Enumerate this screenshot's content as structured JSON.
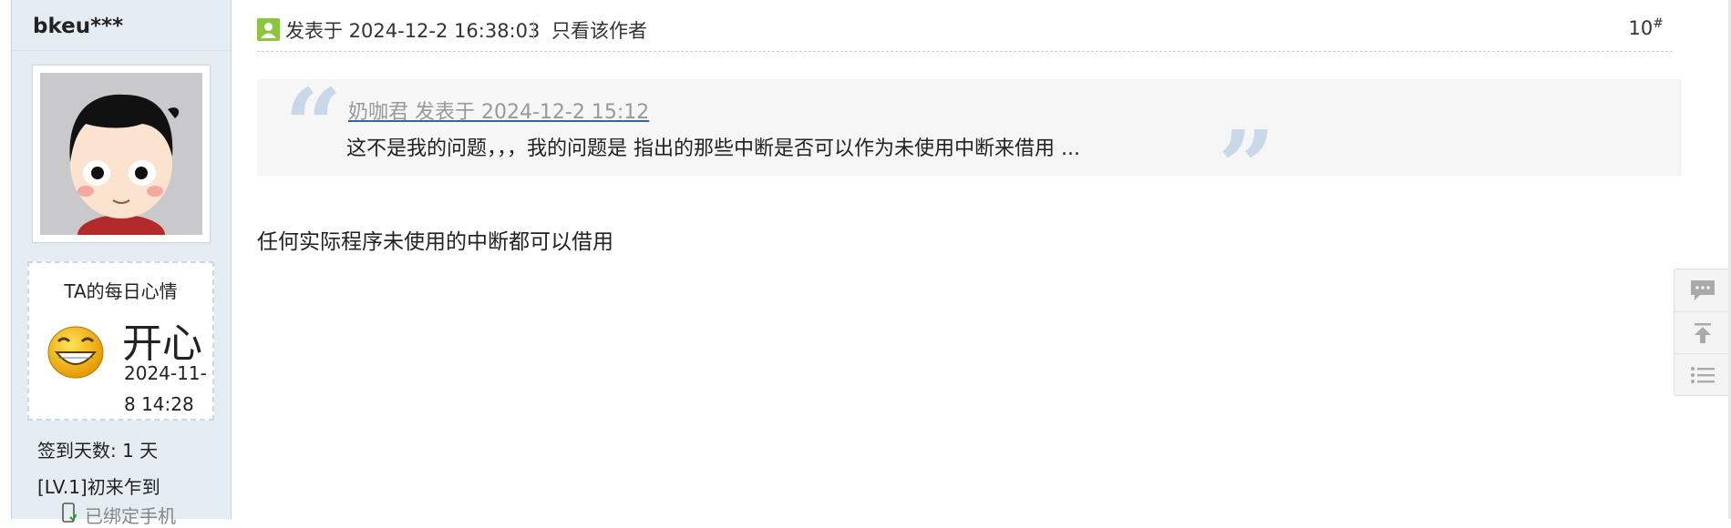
{
  "user": {
    "name": "bkeu***",
    "mood_title": "TA的每日心情",
    "mood": "开心",
    "mood_date": "2024-11-8 14:28",
    "checkin_days": "签到天数: 1 天",
    "level": "[LV.1]初来乍到",
    "phone_bound": "已绑定手机"
  },
  "post": {
    "time": "发表于 2024-12-2 16:38:03",
    "only_author": "只看该作者",
    "floor": "10",
    "floor_mark": "#"
  },
  "quote": {
    "author_line": "奶咖君   发表于 2024-12-2 15:12",
    "text": "这不是我的问题，，，我的问题是  指出的那些中断是否可以作为未使用中断来借用 ..."
  },
  "reply": "任何实际程序未使用的中断都可以借用",
  "tools": [
    {
      "icon": "comment-icon"
    },
    {
      "icon": "back-to-top-icon"
    },
    {
      "icon": "list-icon"
    }
  ],
  "colors": {
    "sidebar_bg": "#e5edf2",
    "quote_bg": "#f6f6f6",
    "quote_mark": "#c8d8e8",
    "author_icon": "#8cc63f"
  }
}
